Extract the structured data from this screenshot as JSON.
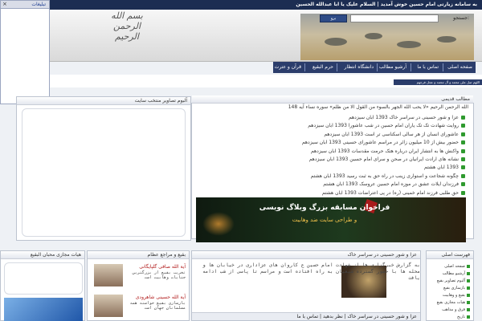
{
  "topbar": {
    "ticker": "به سامانه زیارتی امام حسین خوش آمدید | السلام علیک یا ابا عبدالله الحسین"
  },
  "header": {
    "logo_text": "بسم الله الرحمن الرحیم",
    "search_label": "جستجو:",
    "search_button": "برو"
  },
  "nav": {
    "items": [
      "صفحه اصلی",
      "تماس با ما",
      "آرشیو مطالب",
      "دانشگاه انتظار",
      "حرم البقیع",
      "قرآن و عترت"
    ]
  },
  "notification": {
    "title": "تبلیغات",
    "close": "×"
  },
  "strip": {
    "text": "اللهم صل علی محمد و آل محمد و عجل فرجهم"
  },
  "news_list": {
    "header": "مطالب قدیمی",
    "intro": "الله الرحمن الرحیم «لا یحب الله الجهر بالسوء من القول الا من ظلم» سوره نساء آیه 148",
    "items": [
      "عزا و شور حسینی در سراسر خاک 1393 آبان سیزدهم",
      "روایت شهادت تک تک یاران امام حسین در شب عاشورا 1393 آبان سیزدهم",
      "عاشورای انسان از هر سالی اسکناسی تر است 1393 آبان سیزدهم",
      "حضور بیش از 10 میلیون زائر در مراسم عاشورای حسینی 1393 آبان سیزدهم",
      "واکنش ها به انتشار ایران درباره هتک حرمت مقدسات 1393 آبان سیزدهم",
      "نشانه های ارادت ایرانیان در صحن و سرای امام حسین 1393 آبان سیزدهم",
      "1393 آبان هشتم",
      "چگونه شجاعت و استواری زینب در راه حق به ثبت رسید 1393 آبان هشتم",
      "فرزندان ایلات عشق در موزه امام حسین عروسک 1393 آبان هشتم",
      "حق طلبی فرزند امام خمینی (ره) در پی اعتراضات 1393 آبان هشتم"
    ]
  },
  "banner": {
    "line1": "فراخوان مسابقه بزرگ وبلاگ نویسی",
    "line2": "و طراحی سایت ضد وهابیت"
  },
  "gallery": {
    "header": "آلبوم تصاویر منتخب سایت"
  },
  "menu": {
    "header": "فهرست اصلی",
    "items": [
      "صفحه اصلی",
      "آرشیو مطالب",
      "آلبوم تصاویر بقیع",
      "بازسازی بقیع",
      "بقیع و وهابیت",
      "هیات مجازی بقیع",
      "فرق و مذاهب",
      "تاریخ"
    ]
  },
  "center_news": {
    "header": "عزا و شور حسینی در سراسر خاک",
    "text": "به گزارش خبرگزاری ها از شهادت امام حسین ع کاروان های عزاداری در خیابان ها و محله ها با حضور گسترده شیعیان به راه افتاده است و مراسم تا پاسی از شب ادامه یافت",
    "footer": "عزا و شور حسینی در سراسر خاک | نظر بدهید | تماس با ما"
  },
  "scholars": {
    "header": "بقیع و مراجع عظام",
    "items": [
      {
        "name": "آیة الله صافی گلپایگانی",
        "desc": "تخریب بقیع از بزرگترین جنایات وهابیت است"
      },
      {
        "name": "آیة الله حسینی شاهرودی",
        "desc": "بازسازی بقیع خواسته همه مسلمانان جهان است"
      }
    ]
  },
  "bottom_left": {
    "header": "هیات مجازی محبان البقیع"
  }
}
